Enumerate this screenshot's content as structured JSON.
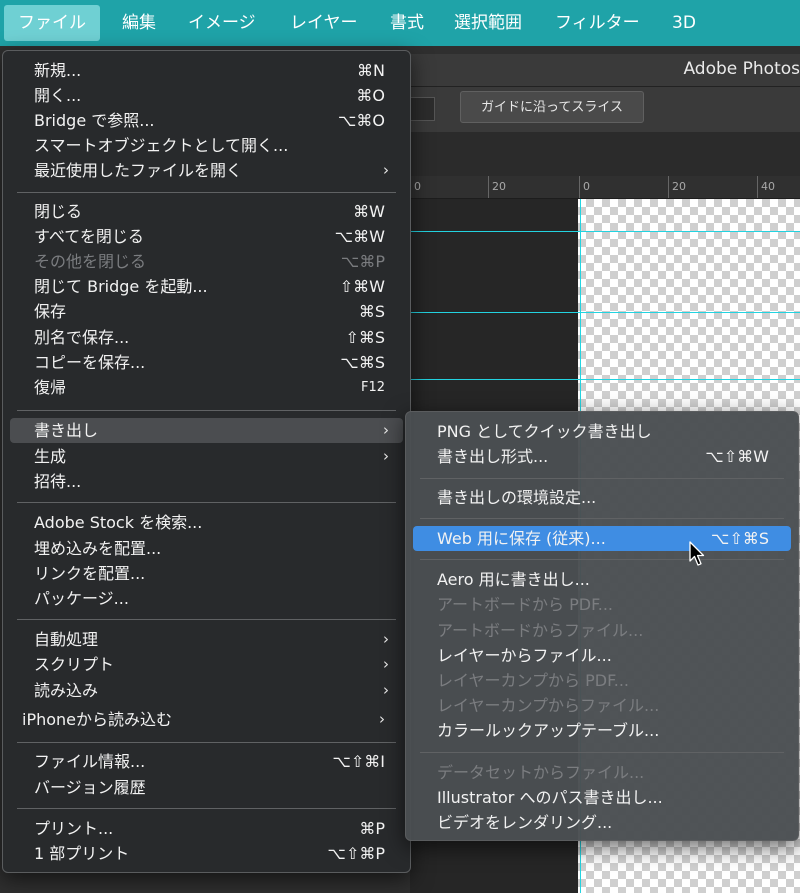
{
  "menubar": {
    "items": [
      "ファイル",
      "編集",
      "イメージ",
      "レイヤー",
      "書式",
      "選択範囲",
      "フィルター",
      "3D"
    ]
  },
  "photoshop": {
    "window_title": "Adobe Photos",
    "guide_slice_button": "ガイドに沿ってスライス",
    "ruler_labels": [
      "0",
      "20",
      "0",
      "20",
      "40"
    ]
  },
  "file_menu": {
    "groups": [
      [
        {
          "label": "新規...",
          "shortcut": "⌘N"
        },
        {
          "label": "開く...",
          "shortcut": "⌘O"
        },
        {
          "label": "Bridge で参照...",
          "shortcut": "⌥⌘O"
        },
        {
          "label": "スマートオブジェクトとして開く...",
          "shortcut": ""
        },
        {
          "label": "最近使用したファイルを開く",
          "shortcut": "",
          "submenu": true
        }
      ],
      [
        {
          "label": "閉じる",
          "shortcut": "⌘W"
        },
        {
          "label": "すべてを閉じる",
          "shortcut": "⌥⌘W"
        },
        {
          "label": "その他を閉じる",
          "shortcut": "⌥⌘P",
          "disabled": true
        },
        {
          "label": "閉じて Bridge を起動...",
          "shortcut": "⇧⌘W"
        },
        {
          "label": "保存",
          "shortcut": "⌘S"
        },
        {
          "label": "別名で保存...",
          "shortcut": "⇧⌘S"
        },
        {
          "label": "コピーを保存...",
          "shortcut": "⌥⌘S"
        },
        {
          "label": "復帰",
          "shortcut": "F12"
        }
      ],
      [
        {
          "label": "書き出し",
          "shortcut": "",
          "submenu": true,
          "open": true
        },
        {
          "label": "生成",
          "shortcut": "",
          "submenu": true
        },
        {
          "label": "招待...",
          "shortcut": ""
        }
      ],
      [
        {
          "label": "Adobe Stock を検索...",
          "shortcut": ""
        },
        {
          "label": "埋め込みを配置...",
          "shortcut": ""
        },
        {
          "label": "リンクを配置...",
          "shortcut": ""
        },
        {
          "label": "パッケージ...",
          "shortcut": ""
        }
      ],
      [
        {
          "label": "自動処理",
          "shortcut": "",
          "submenu": true
        },
        {
          "label": "スクリプト",
          "shortcut": "",
          "submenu": true
        },
        {
          "label": "読み込み",
          "shortcut": "",
          "submenu": true
        },
        {
          "label": "iPhoneから読み込む",
          "shortcut": "",
          "submenu": true
        }
      ],
      [
        {
          "label": "ファイル情報...",
          "shortcut": "⌥⇧⌘I"
        },
        {
          "label": "バージョン履歴",
          "shortcut": ""
        }
      ],
      [
        {
          "label": "プリント...",
          "shortcut": "⌘P"
        },
        {
          "label": "1 部プリント",
          "shortcut": "⌥⇧⌘P"
        }
      ]
    ]
  },
  "export_menu": {
    "groups": [
      [
        {
          "label": "PNG としてクイック書き出し",
          "shortcut": ""
        },
        {
          "label": "書き出し形式...",
          "shortcut": "⌥⇧⌘W"
        }
      ],
      [
        {
          "label": "書き出しの環境設定...",
          "shortcut": ""
        }
      ],
      [
        {
          "label": "Web 用に保存 (従来)...",
          "shortcut": "⌥⇧⌘S",
          "selected": true
        }
      ],
      [
        {
          "label": "Aero 用に書き出し...",
          "shortcut": ""
        },
        {
          "label": "アートボードから PDF...",
          "shortcut": "",
          "disabled": true
        },
        {
          "label": "アートボードからファイル...",
          "shortcut": "",
          "disabled": true
        },
        {
          "label": "レイヤーからファイル...",
          "shortcut": ""
        },
        {
          "label": "レイヤーカンプから PDF...",
          "shortcut": "",
          "disabled": true
        },
        {
          "label": "レイヤーカンプからファイル...",
          "shortcut": "",
          "disabled": true
        },
        {
          "label": "カラールックアップテーブル...",
          "shortcut": ""
        }
      ],
      [
        {
          "label": "データセットからファイル...",
          "shortcut": "",
          "disabled": true
        },
        {
          "label": "Illustrator へのパス書き出し...",
          "shortcut": ""
        },
        {
          "label": "ビデオをレンダリング...",
          "shortcut": ""
        }
      ]
    ]
  },
  "colors": {
    "menubar": "#1fa3a8",
    "selected_item": "#3f8de3",
    "guides": "#23d3e0"
  },
  "icons": {
    "submenu": "chevron-right-icon",
    "cursor": "arrow-cursor-icon"
  }
}
